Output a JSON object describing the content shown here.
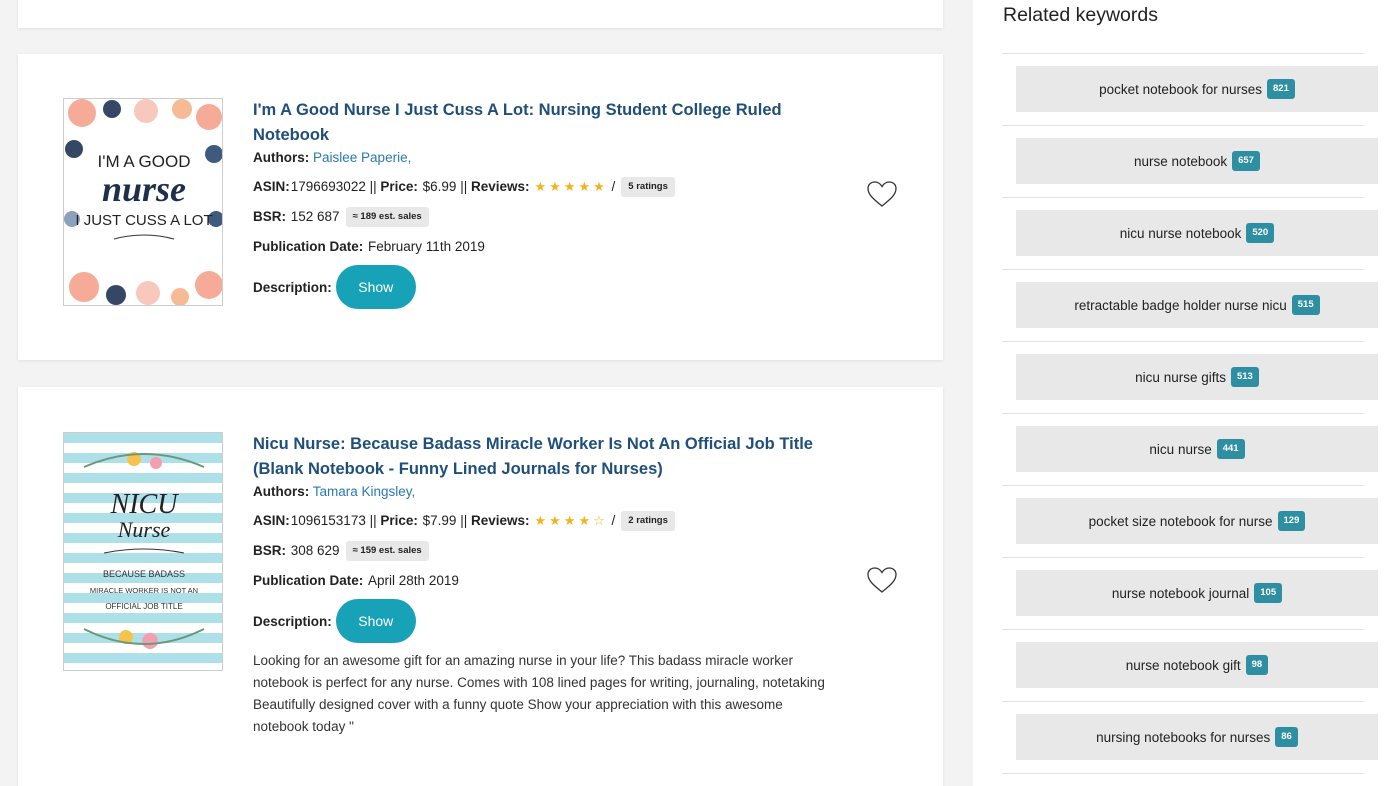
{
  "books": [
    {
      "title": "I'm A Good Nurse I Just Cuss A Lot: Nursing Student College Ruled Notebook",
      "authors_label": "Authors:",
      "author": "Paislee Paperie,",
      "asin_label": "ASIN:",
      "asin": "1796693022",
      "price_label": "Price:",
      "price": "$6.99",
      "reviews_label": "Reviews:",
      "stars": "★★★★★",
      "ratings": "5 ratings",
      "bsr_label": "BSR:",
      "bsr": "152 687",
      "est_sales": "≈ 189 est. sales",
      "pubdate_label": "Publication Date:",
      "pubdate": "February 11th 2019",
      "description_label": "Description:",
      "show_label": "Show",
      "description": "",
      "cover_lines": [
        "I'M A GOOD",
        "nurse",
        "I JUST CUSS A LOT"
      ]
    },
    {
      "title": "Nicu Nurse: Because Badass Miracle Worker Is Not An Official Job Title (Blank Notebook - Funny Lined Journals for Nurses)",
      "authors_label": "Authors:",
      "author": "Tamara Kingsley,",
      "asin_label": "ASIN:",
      "asin": "1096153173",
      "price_label": "Price:",
      "price": "$7.99",
      "reviews_label": "Reviews:",
      "stars": "★★★★☆",
      "ratings": "2 ratings",
      "bsr_label": "BSR:",
      "bsr": "308 629",
      "est_sales": "≈ 159 est. sales",
      "pubdate_label": "Publication Date:",
      "pubdate": "April 28th 2019",
      "description_label": "Description:",
      "show_label": "Show",
      "description": "Looking for an awesome gift for an amazing nurse in your life? This badass miracle worker notebook is perfect for any nurse. Comes with 108 lined pages for writing, journaling, notetaking Beautifully designed cover with a funny quote Show your appreciation with this awesome notebook today \"",
      "cover_lines": [
        "NICU",
        "Nurse",
        "BECAUSE BADASS",
        "MIRACLE WORKER IS NOT AN",
        "OFFICIAL JOB TITLE"
      ]
    }
  ],
  "related": {
    "title": "Related keywords",
    "items": [
      {
        "keyword": "pocket notebook for nurses",
        "count": "821"
      },
      {
        "keyword": "nurse notebook",
        "count": "657"
      },
      {
        "keyword": "nicu nurse notebook",
        "count": "520"
      },
      {
        "keyword": "retractable badge holder nurse nicu",
        "count": "515"
      },
      {
        "keyword": "nicu nurse gifts",
        "count": "513"
      },
      {
        "keyword": "nicu nurse",
        "count": "441"
      },
      {
        "keyword": "pocket size notebook for nurse",
        "count": "129"
      },
      {
        "keyword": "nurse notebook journal",
        "count": "105"
      },
      {
        "keyword": "nurse notebook gift",
        "count": "98"
      },
      {
        "keyword": "nursing notebooks for nurses",
        "count": "86"
      }
    ]
  },
  "colors": {
    "accent": "#17a2b8",
    "badge": "#2e8fa3",
    "title": "#1f4f7a",
    "star": "#f3b31b"
  }
}
